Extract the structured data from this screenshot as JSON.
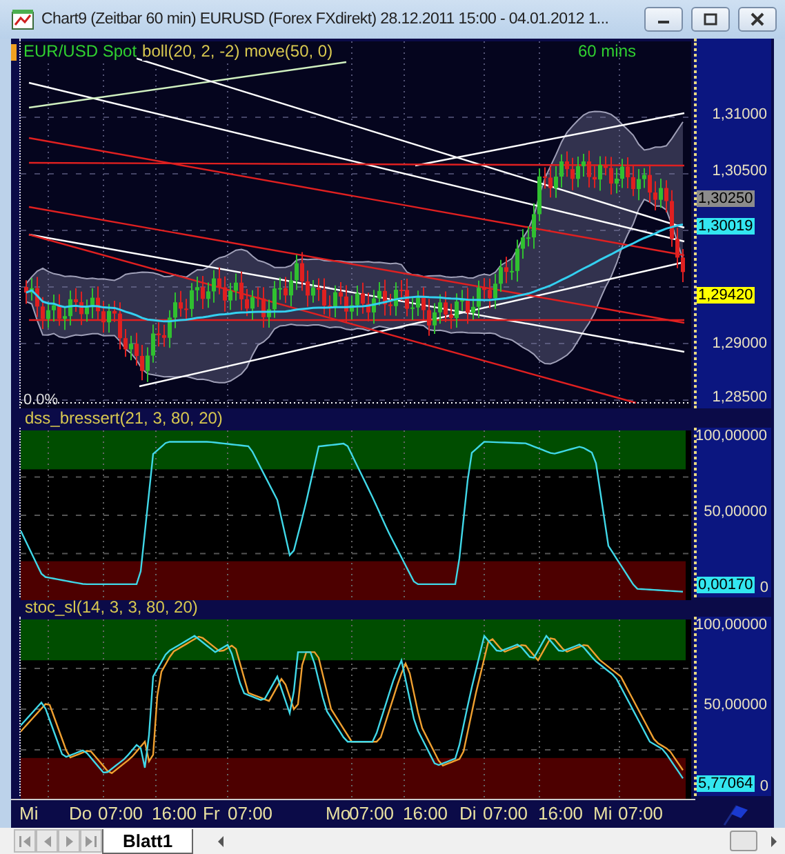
{
  "window": {
    "title": "Chart9 (Zeitbar 60 min)  EURUSD (Forex FXdirekt) 28.12.2011 15:00 - 04.01.2012 1..."
  },
  "panels": [
    {
      "kind": "price",
      "symbol": "EUR/USD Spot",
      "studies": "boll(20, 2, -2) move(50, 0)",
      "interval": "60 mins",
      "footnote": "0.0%",
      "axis_labels": [
        "1,31000",
        "1,30500",
        "1,29000",
        "1,28500"
      ],
      "tags": [
        {
          "text": "1,30250",
          "color": "#8c8c8c"
        },
        {
          "text": "1,30019",
          "color": "#33e6f0"
        },
        {
          "text": "1,29420",
          "color": "#ffff00"
        }
      ]
    },
    {
      "kind": "dss",
      "title": "dss_bressert(21, 3, 80, 20)",
      "axis_labels": [
        "100,00000",
        "50,00000",
        "0"
      ],
      "tags": [
        {
          "text": "0,00170",
          "color": "#33e6f0"
        }
      ]
    },
    {
      "kind": "stochastic",
      "title": "stoc_sl(14, 3, 3, 80, 20)",
      "axis_labels": [
        "100,00000",
        "50,00000",
        "0"
      ],
      "tags": [
        {
          "text": "5,77064",
          "color": "#33e6f0"
        }
      ]
    }
  ],
  "time_axis": [
    "Mi",
    "Do",
    "07:00",
    "16:00",
    "Fr",
    "07:00",
    "Mo",
    "07:00",
    "16:00",
    "Di",
    "07:00",
    "16:00",
    "Mi",
    "07:00"
  ],
  "sheet_tabs": [
    {
      "label": "Blatt1",
      "selected": true
    }
  ]
}
